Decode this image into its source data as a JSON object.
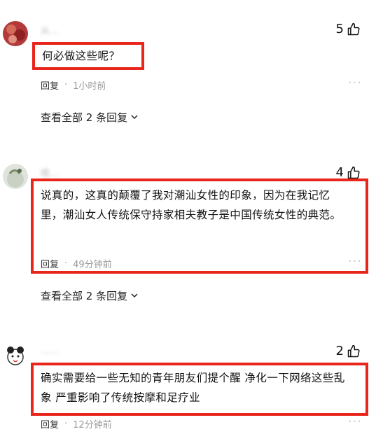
{
  "comments": [
    {
      "user": "从…",
      "likes": "5",
      "text": "何必做这些呢？",
      "reply_label": "回复",
      "time": "1小时前",
      "view_all": "查看全部 2 条回复"
    },
    {
      "user": "嗯…",
      "likes": "4",
      "text": "说真的，这真的颠覆了我对潮汕女性的印象，因为在我记忆里，潮汕女人传统保守持家相夫教子是中国传统女性的典范。",
      "reply_label": "回复",
      "time": "49分钟前",
      "view_all": "查看全部 2 条回复"
    },
    {
      "user": "……",
      "likes": "2",
      "text": "确实需要给一些无知的青年朋友们提个醒 净化一下网络这些乱象 严重影响了传统按摩和足疗业",
      "reply_label": "回复",
      "time": "12分钟前"
    }
  ],
  "icons": {
    "like": "thumb-up-icon",
    "more": "more-dots-icon",
    "expand": "chevron-down-icon"
  },
  "colors": {
    "highlight": "#e8261c",
    "muted": "#999999"
  }
}
